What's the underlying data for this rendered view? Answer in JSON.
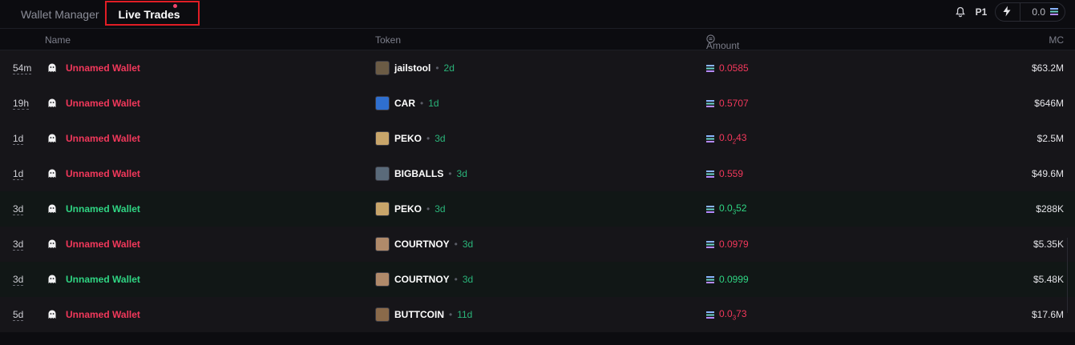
{
  "tabs": [
    {
      "label": "Wallet Manager"
    },
    {
      "label": "Live Trades"
    }
  ],
  "controls": {
    "preset": "P1",
    "quick_buy_value": "0.0"
  },
  "columns": {
    "name": "Name",
    "token": "Token",
    "amount": "Amount",
    "mc": "MC"
  },
  "rows": [
    {
      "age": "54m",
      "wallet": "Unnamed Wallet",
      "side": "sell",
      "token": "jailstool",
      "token_age": "2d",
      "amount_main": "0.0585",
      "amount_sub": "",
      "amount_tail": "",
      "mc": "$63.2M",
      "token_color": "#6b5b45"
    },
    {
      "age": "19h",
      "wallet": "Unnamed Wallet",
      "side": "sell",
      "token": "CAR",
      "token_age": "1d",
      "amount_main": "0.5707",
      "amount_sub": "",
      "amount_tail": "",
      "mc": "$646M",
      "token_color": "#2f6fcf"
    },
    {
      "age": "1d",
      "wallet": "Unnamed Wallet",
      "side": "sell",
      "token": "PEKO",
      "token_age": "3d",
      "amount_main": "0.0",
      "amount_sub": "2",
      "amount_tail": "43",
      "mc": "$2.5M",
      "token_color": "#c8a56a"
    },
    {
      "age": "1d",
      "wallet": "Unnamed Wallet",
      "side": "sell",
      "token": "BIGBALLS",
      "token_age": "3d",
      "amount_main": "0.559",
      "amount_sub": "",
      "amount_tail": "",
      "mc": "$49.6M",
      "token_color": "#5a6a7a"
    },
    {
      "age": "3d",
      "wallet": "Unnamed Wallet",
      "side": "buy",
      "token": "PEKO",
      "token_age": "3d",
      "amount_main": "0.0",
      "amount_sub": "3",
      "amount_tail": "52",
      "mc": "$288K",
      "token_color": "#c8a56a"
    },
    {
      "age": "3d",
      "wallet": "Unnamed Wallet",
      "side": "sell",
      "token": "COURTNOY",
      "token_age": "3d",
      "amount_main": "0.0979",
      "amount_sub": "",
      "amount_tail": "",
      "mc": "$5.35K",
      "token_color": "#b08a6a"
    },
    {
      "age": "3d",
      "wallet": "Unnamed Wallet",
      "side": "buy",
      "token": "COURTNOY",
      "token_age": "3d",
      "amount_main": "0.0999",
      "amount_sub": "",
      "amount_tail": "",
      "mc": "$5.48K",
      "token_color": "#b08a6a"
    },
    {
      "age": "5d",
      "wallet": "Unnamed Wallet",
      "side": "sell",
      "token": "BUTTCOIN",
      "token_age": "11d",
      "amount_main": "0.0",
      "amount_sub": "3",
      "amount_tail": "73",
      "mc": "$17.6M",
      "token_color": "#8a6a4a"
    }
  ]
}
